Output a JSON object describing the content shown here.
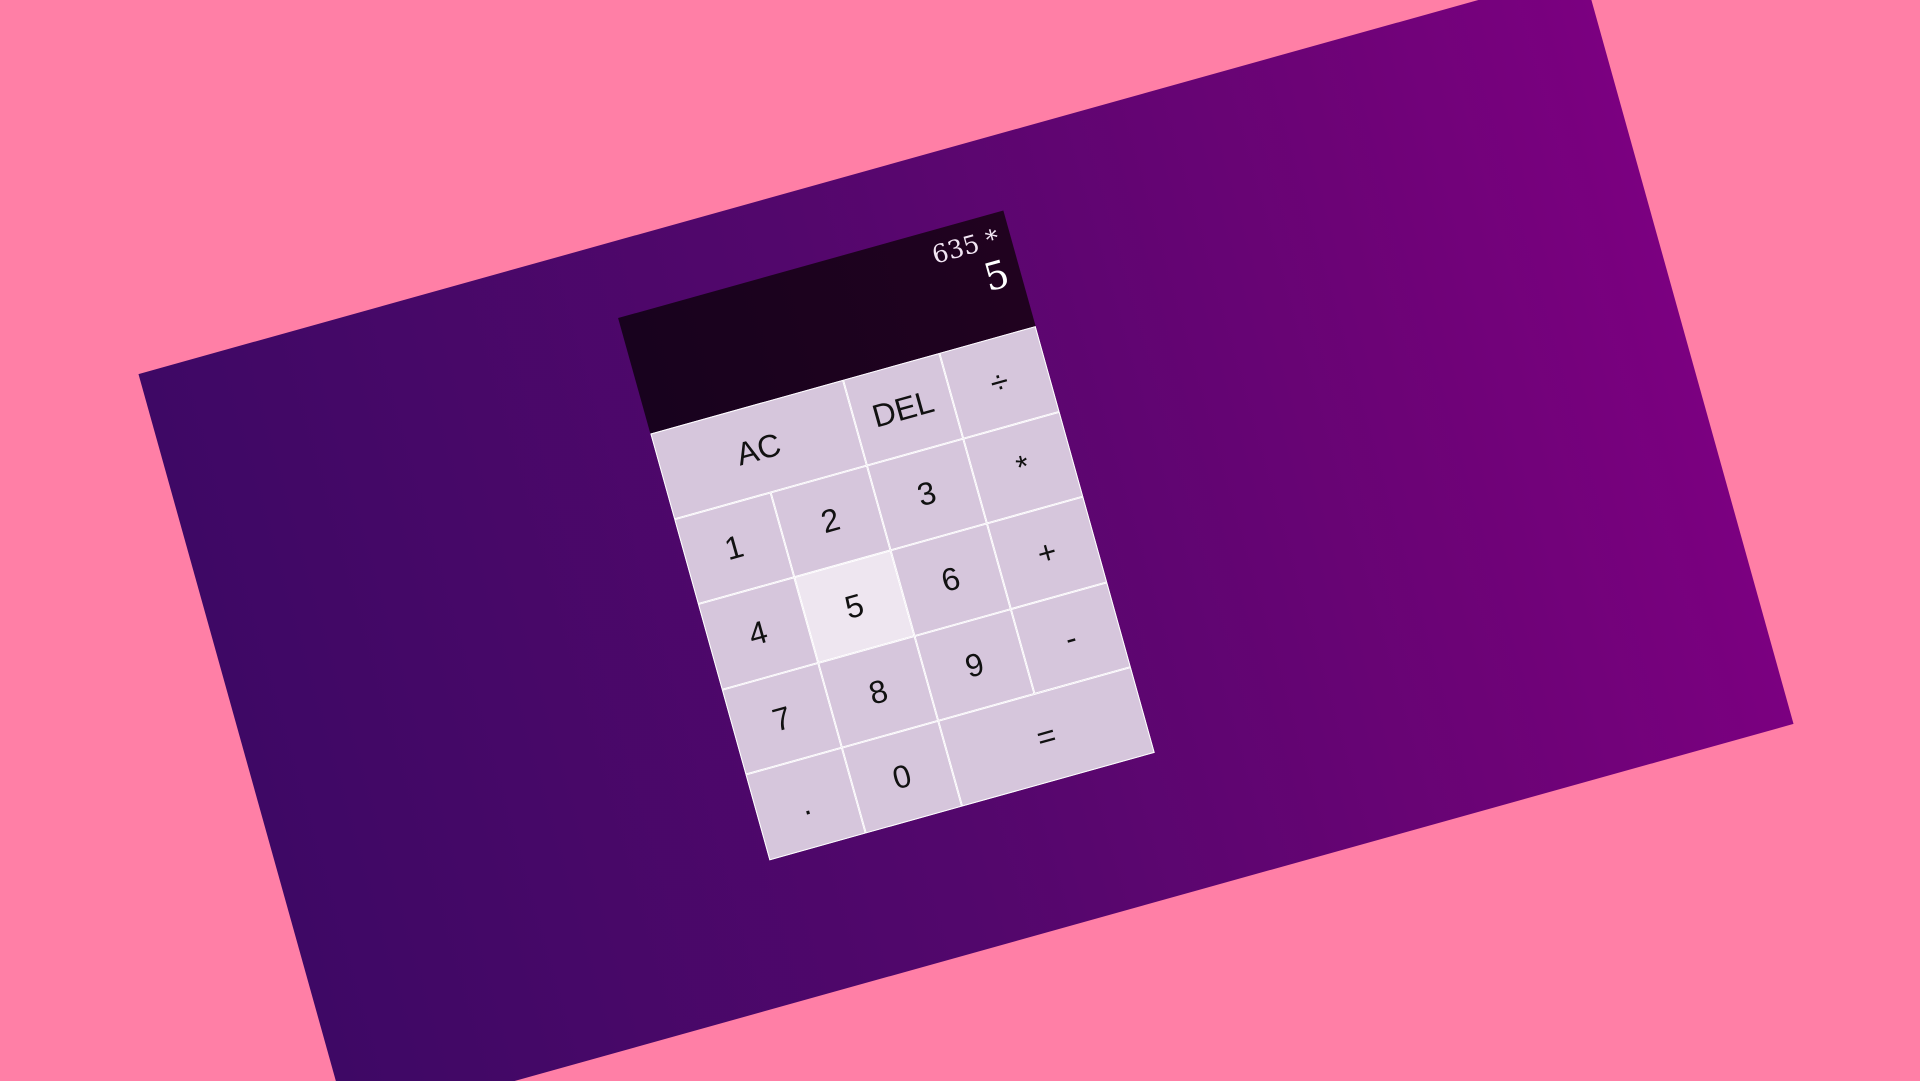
{
  "display": {
    "previous_operand": "635 *",
    "current_operand": "5"
  },
  "keypad": {
    "ac": "AC",
    "del": "DEL",
    "divide": "÷",
    "one": "1",
    "two": "2",
    "three": "3",
    "multiply": "*",
    "four": "4",
    "five": "5",
    "six": "6",
    "plus": "+",
    "seven": "7",
    "eight": "8",
    "nine": "9",
    "minus": "-",
    "decimal": ".",
    "zero": "0",
    "equals": "=",
    "pressed_key": "5"
  },
  "colors": {
    "page_background": "#ff7fa6",
    "panel_gradient_start": "#3e0865",
    "panel_gradient_end": "#7b0080",
    "display_background": "#18021e",
    "key_background": "#d6c6dc",
    "key_active_background": "#eee6f0",
    "key_border": "#ffffff"
  }
}
